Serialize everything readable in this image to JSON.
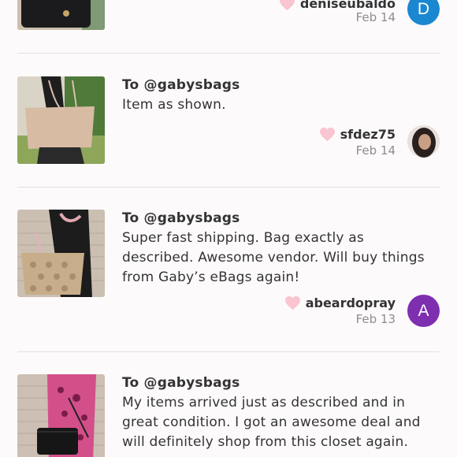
{
  "reviews": [
    {
      "recipient": "",
      "comment": "",
      "reviewer": "deniseubaldo",
      "date": "Feb 14",
      "avatar_letter": "D",
      "avatar_color": "#1b87d1"
    },
    {
      "recipient": "To @gabysbags",
      "comment": "Item as shown.",
      "reviewer": "sfdez75",
      "date": "Feb 14",
      "avatar_letter": "",
      "avatar_color": ""
    },
    {
      "recipient": "To @gabysbags",
      "comment": "Super fast shipping. Bag exactly as described. Awesome vendor. Will buy things from Gaby’s eBags again!",
      "reviewer": "abeardopray",
      "date": "Feb 13",
      "avatar_letter": "A",
      "avatar_color": "#7e2fb0"
    },
    {
      "recipient": "To @gabysbags",
      "comment": "My items arrived just as described and in great condition. I got an awesome deal and will definitely shop from this closet again.",
      "reviewer": "",
      "date": "",
      "avatar_letter": "",
      "avatar_color": ""
    }
  ],
  "colors": {
    "heart": "#f8c5d0",
    "text": "#333335",
    "muted": "#8d8d8f",
    "divider": "#e2e0e0"
  },
  "icons": {
    "like": "heart-icon"
  }
}
